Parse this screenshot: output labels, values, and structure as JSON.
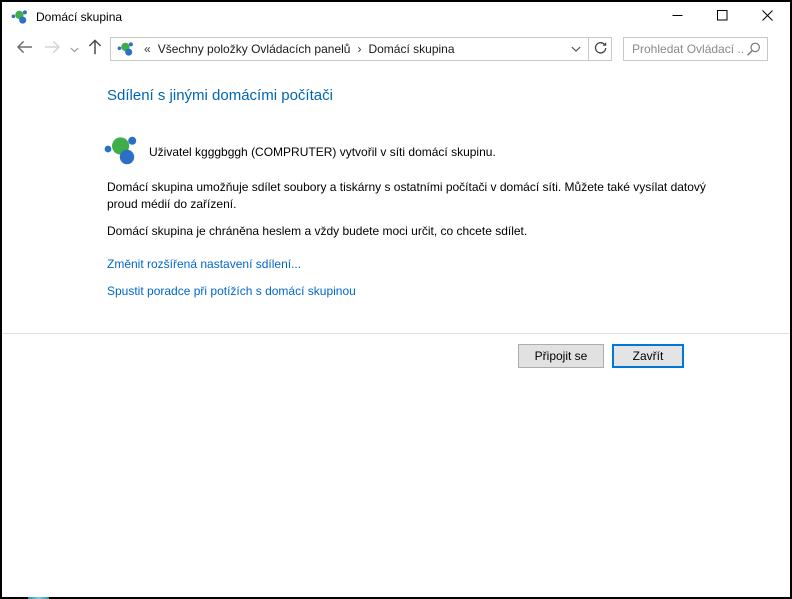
{
  "window": {
    "title": "Domácí skupina"
  },
  "toolbar": {
    "breadcrumb": {
      "overflow": "«",
      "separator": "›",
      "items": [
        "Všechny položky Ovládacích panelů",
        "Domácí skupina"
      ]
    },
    "search": {
      "placeholder": "Prohledat Ovládací ...",
      "value": ""
    }
  },
  "content": {
    "heading": "Sdílení s jinými domácími počítači",
    "status": "Uživatel kgggbggh (COMPRUTER) vytvořil v síti domácí skupinu.",
    "description": "Domácí skupina umožňuje sdílet soubory a tiskárny s ostatními počítači v domácí síti. Můžete také vysílat datový proud médií do zařízení.",
    "password_note": "Domácí skupina je chráněna heslem a vždy budete moci určit, co chcete sdílet.",
    "links": {
      "advanced_sharing": "Změnit rozšířená nastavení sdílení...",
      "troubleshooter": "Spustit poradce při potížích s domácí skupinou"
    }
  },
  "footer": {
    "join_label": "Připojit se",
    "close_label": "Zavřít"
  },
  "icons": {
    "app": "homegroup-icon",
    "back": "back-arrow-icon",
    "forward": "forward-arrow-icon",
    "history": "chevron-down-icon",
    "up": "up-arrow-icon",
    "address_dropdown": "chevron-down-icon",
    "refresh": "refresh-icon",
    "search": "magnifier-icon",
    "minimize": "minimize-icon",
    "maximize": "maximize-icon",
    "close": "close-icon"
  },
  "colors": {
    "window_border": "#000000",
    "heading_blue": "#0066b4",
    "link_blue": "#0066cc",
    "default_button_border": "#0078d7",
    "button_face": "#e1e1e1",
    "homegroup_green": "#3fae4a",
    "homegroup_blue": "#2b6fc6",
    "placeholder_gray": "#8a8a8a"
  }
}
